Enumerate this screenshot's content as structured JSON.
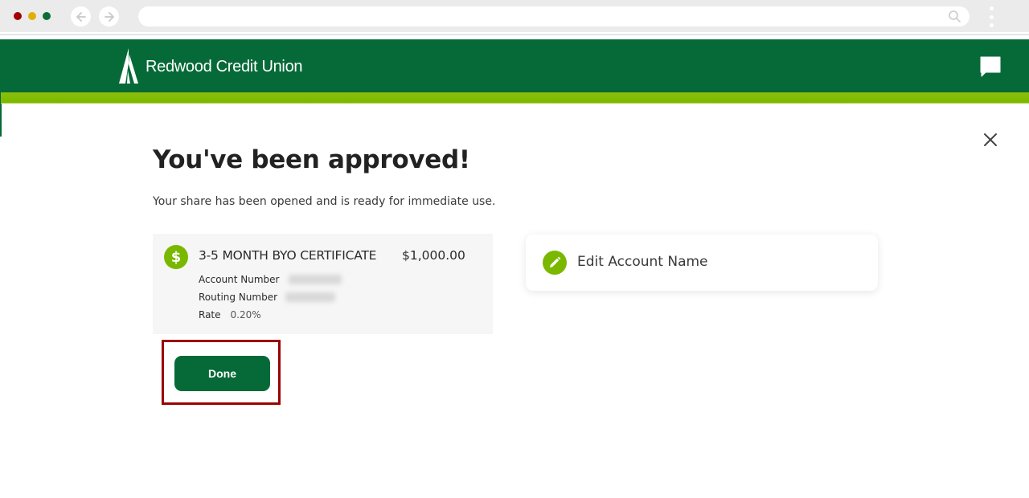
{
  "browser": {
    "address_value": "",
    "icons": {
      "back": "arrow-left-icon",
      "forward": "arrow-right-icon",
      "search": "search-icon",
      "menu": "kebab-menu-icon"
    }
  },
  "header": {
    "brand_name": "Redwood Credit Union",
    "logo_icon": "redwood-tree-logo",
    "chat_icon": "chat-bubble-icon",
    "colors": {
      "primary": "#066a38",
      "accent": "#7ab800"
    }
  },
  "dialog": {
    "close_icon": "close-icon",
    "title": "You've been approved!",
    "subtitle": "Your share has been opened and is ready for immediate use."
  },
  "account": {
    "icon": "dollar-icon",
    "icon_glyph": "$",
    "name": "3-5 MONTH BYO CERTIFICATE",
    "amount": "$1,000.00",
    "details": [
      {
        "label": "Account Number",
        "value": "[redacted]"
      },
      {
        "label": "Routing Number",
        "value": "[redacted]"
      },
      {
        "label": "Rate",
        "value": "0.20%"
      }
    ]
  },
  "edit_card": {
    "icon": "pencil-icon",
    "label": "Edit Account Name"
  },
  "actions": {
    "done_label": "Done",
    "highlight_color": "#9b0000"
  }
}
